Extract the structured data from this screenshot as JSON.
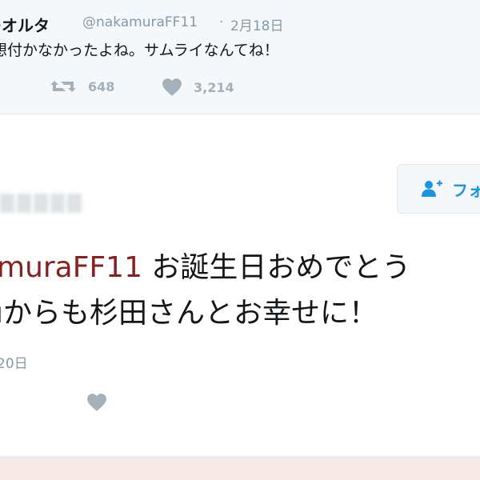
{
  "previous_tweet": {
    "display_name": "ーオルタ",
    "handle": "@nakamuraFF11",
    "separator": "·",
    "date": "2月18日",
    "text": "想付かなかったよね。サムライなんてね！",
    "retweet_count": "648",
    "like_count": "3,214"
  },
  "main_tweet": {
    "follow_label": "フォ",
    "mention": "muraFF11",
    "line1_text": " お誕生日おめでとう",
    "line2_text": "ıからも杉田さんとお幸せに！",
    "date": "20日"
  },
  "icons": {
    "retweet": "retweet-icon",
    "like": "heart-icon",
    "follow": "follow-person-plus-icon"
  },
  "colors": {
    "accent": "#1b95e0",
    "mention": "#8a1f1f",
    "muted": "#8899a6",
    "action_icon": "#a5b1ba"
  }
}
